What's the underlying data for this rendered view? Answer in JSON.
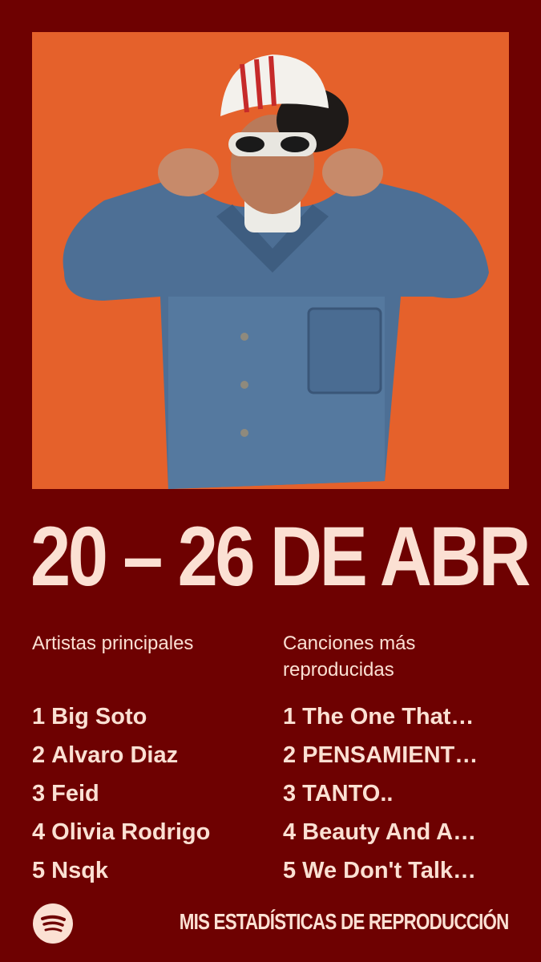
{
  "header": {
    "date_range": "20 – 26 DE ABR"
  },
  "artists": {
    "title": "Artistas principales",
    "items": [
      {
        "rank": "1",
        "name": "Big Soto"
      },
      {
        "rank": "2",
        "name": "Alvaro Diaz"
      },
      {
        "rank": "3",
        "name": "Feid"
      },
      {
        "rank": "4",
        "name": "Olivia Rodrigo"
      },
      {
        "rank": "5",
        "name": "Nsqk"
      }
    ]
  },
  "songs": {
    "title": "Canciones más reproducidas",
    "items": [
      {
        "rank": "1",
        "name": "The One That…"
      },
      {
        "rank": "2",
        "name": "PENSAMIENT…"
      },
      {
        "rank": "3",
        "name": "TANTO.."
      },
      {
        "rank": "4",
        "name": "Beauty And A…"
      },
      {
        "rank": "5",
        "name": "We Don't Talk…"
      }
    ]
  },
  "footer": {
    "label": "MIS ESTADÍSTICAS DE REPRODUCCIÓN",
    "logo_icon": "spotify-logo-icon"
  },
  "colors": {
    "background": "#6e0101",
    "text": "#fbe0d3",
    "photo_background": "#e5612b"
  }
}
